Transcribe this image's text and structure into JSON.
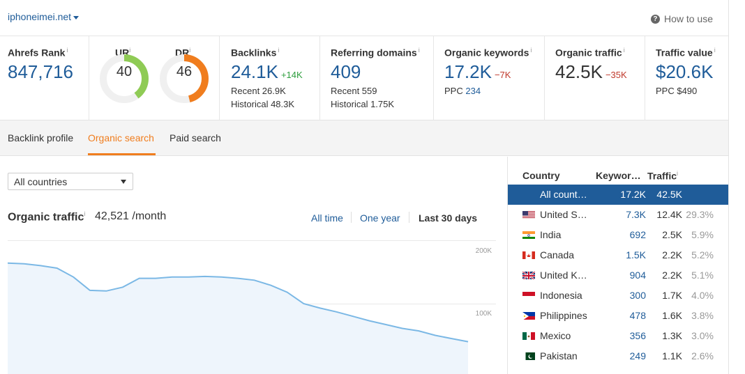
{
  "header": {
    "domain": "iphoneimei.net",
    "how_to_use": "How to use"
  },
  "metrics": {
    "ahrefs_rank": {
      "label": "Ahrefs Rank",
      "info": "i",
      "value": "847,716"
    },
    "ur": {
      "label": "UR",
      "info": "i",
      "value": "40",
      "fraction": 0.4,
      "color": "#8fcb55"
    },
    "dr": {
      "label": "DR",
      "info": "i",
      "value": "46",
      "fraction": 0.46,
      "color": "#f07d1e"
    },
    "backlinks": {
      "label": "Backlinks",
      "info": "i",
      "value": "24.1K",
      "delta": "+14K",
      "recent": "Recent 26.9K",
      "historical": "Historical 48.3K"
    },
    "referring_domains": {
      "label": "Referring domains",
      "info": "i",
      "value": "409",
      "recent": "Recent 559",
      "historical": "Historical 1.75K"
    },
    "organic_keywords": {
      "label": "Organic keywords",
      "info": "i",
      "value": "17.2K",
      "delta": "−7K",
      "ppc_label": "PPC",
      "ppc_value": "234"
    },
    "organic_traffic": {
      "label": "Organic traffic",
      "info": "i",
      "value": "42.5K",
      "delta": "−35K"
    },
    "traffic_value": {
      "label": "Traffic value",
      "info": "i",
      "value": "$20.6K",
      "ppc": "PPC $490"
    }
  },
  "tabs": [
    "Backlink profile",
    "Organic search",
    "Paid search"
  ],
  "filters": {
    "country_select": "All countries"
  },
  "organic": {
    "title": "Organic traffic",
    "info": "i",
    "value": "42,521 /month",
    "ranges": [
      "All time",
      "One year",
      "Last 30 days"
    ]
  },
  "chart_data": {
    "type": "area",
    "y_ticks": [
      "200K",
      "100K"
    ],
    "ylim": [
      0,
      200000
    ],
    "values": [
      164000,
      163000,
      160000,
      156000,
      142000,
      121000,
      120000,
      126000,
      140000,
      140000,
      142000,
      142000,
      143000,
      142000,
      140000,
      137000,
      129000,
      118000,
      100000,
      93000,
      87000,
      80000,
      73000,
      67000,
      61000,
      57000,
      50000,
      45000,
      40000
    ],
    "color": "#7bb8e5",
    "fill": "#eef5fc"
  },
  "countries": {
    "headers": {
      "country": "Country",
      "keywords": "Keywor…",
      "traffic": "Traffic",
      "traffic_info": "i"
    },
    "rows": [
      {
        "flag": "",
        "name": "All count…",
        "kw": "17.2K",
        "traffic": "42.5K",
        "pct": "",
        "selected": true
      },
      {
        "flag": "us",
        "name": "United S…",
        "kw": "7.3K",
        "traffic": "12.4K",
        "pct": "29.3%"
      },
      {
        "flag": "in",
        "name": "India",
        "kw": "692",
        "traffic": "2.5K",
        "pct": "5.9%"
      },
      {
        "flag": "ca",
        "name": "Canada",
        "kw": "1.5K",
        "traffic": "2.2K",
        "pct": "5.2%"
      },
      {
        "flag": "gb",
        "name": "United K…",
        "kw": "904",
        "traffic": "2.2K",
        "pct": "5.1%"
      },
      {
        "flag": "id",
        "name": "Indonesia",
        "kw": "300",
        "traffic": "1.7K",
        "pct": "4.0%"
      },
      {
        "flag": "ph",
        "name": "Philippines",
        "kw": "478",
        "traffic": "1.6K",
        "pct": "3.8%"
      },
      {
        "flag": "mx",
        "name": "Mexico",
        "kw": "356",
        "traffic": "1.3K",
        "pct": "3.0%"
      },
      {
        "flag": "pk",
        "name": "Pakistan",
        "kw": "249",
        "traffic": "1.1K",
        "pct": "2.6%"
      }
    ]
  }
}
